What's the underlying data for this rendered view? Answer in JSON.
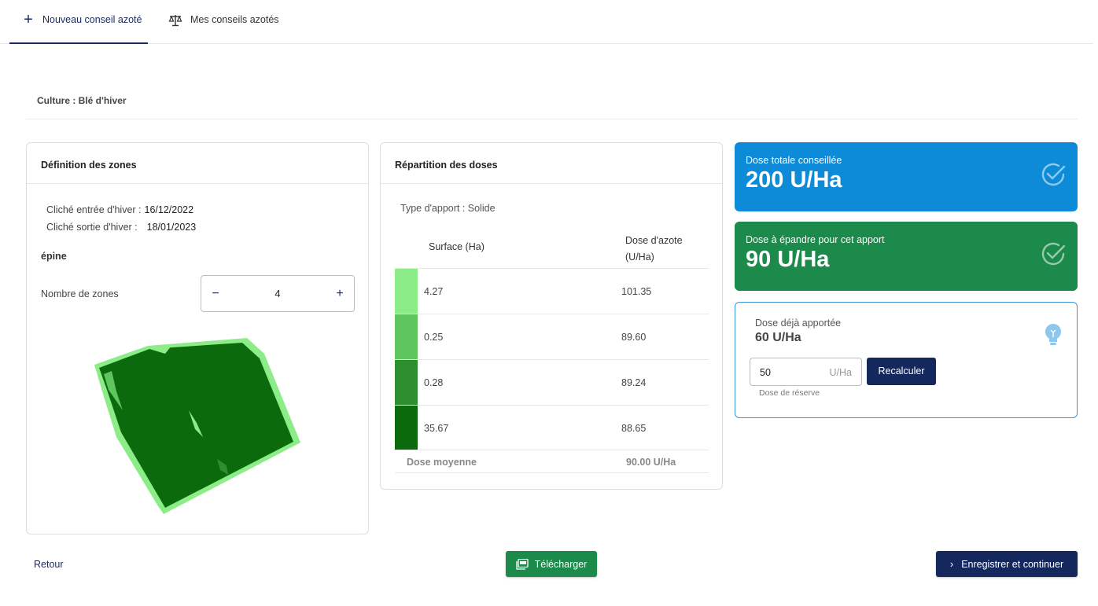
{
  "tabs": {
    "new_label": "Nouveau conseil azoté",
    "list_label": "Mes conseils azotés"
  },
  "culture": "Culture : Blé d'hiver",
  "zones": {
    "title": "Définition des zones",
    "entry_label": "Cliché entrée d'hiver :",
    "entry_date": "16/12/2022",
    "exit_label": "Cliché sortie d'hiver :",
    "exit_date": "18/01/2023",
    "parcel_name": "épine",
    "count_label": "Nombre de zones",
    "count_value": "4",
    "minus": "−",
    "plus": "+"
  },
  "doses": {
    "title": "Répartition des doses",
    "type": "Type d'apport : Solide",
    "col_surface": "Surface (Ha)",
    "col_dose_line1": "Dose d'azote",
    "col_dose_line2": "(U/Ha)",
    "rows": [
      {
        "surface": "4.27",
        "dose": "101.35",
        "color": "#8cec88"
      },
      {
        "surface": "0.25",
        "dose": "89.60",
        "color": "#5fc55e"
      },
      {
        "surface": "0.28",
        "dose": "89.24",
        "color": "#2e8f2f"
      },
      {
        "surface": "35.67",
        "dose": "88.65",
        "color": "#0a6a0c"
      }
    ],
    "avg_label": "Dose moyenne",
    "avg_value": "90.00 U/Ha"
  },
  "summary": {
    "total_label": "Dose totale conseillée",
    "total_value": "200 U/Ha",
    "total_color": "#0d8ad8",
    "spread_label": "Dose à épandre pour cet apport",
    "spread_value": "90 U/Ha",
    "spread_color": "#1b8a4a",
    "already_label": "Dose déjà apportée",
    "already_value": "60 U/Ha",
    "input_value": "50",
    "input_unit": "U/Ha",
    "input_help": "Dose de réserve",
    "recalc_label": "Recalculer"
  },
  "footer": {
    "back_label": "Retour",
    "download_label": "Télécharger",
    "save_label": "Enregistrer et continuer"
  }
}
